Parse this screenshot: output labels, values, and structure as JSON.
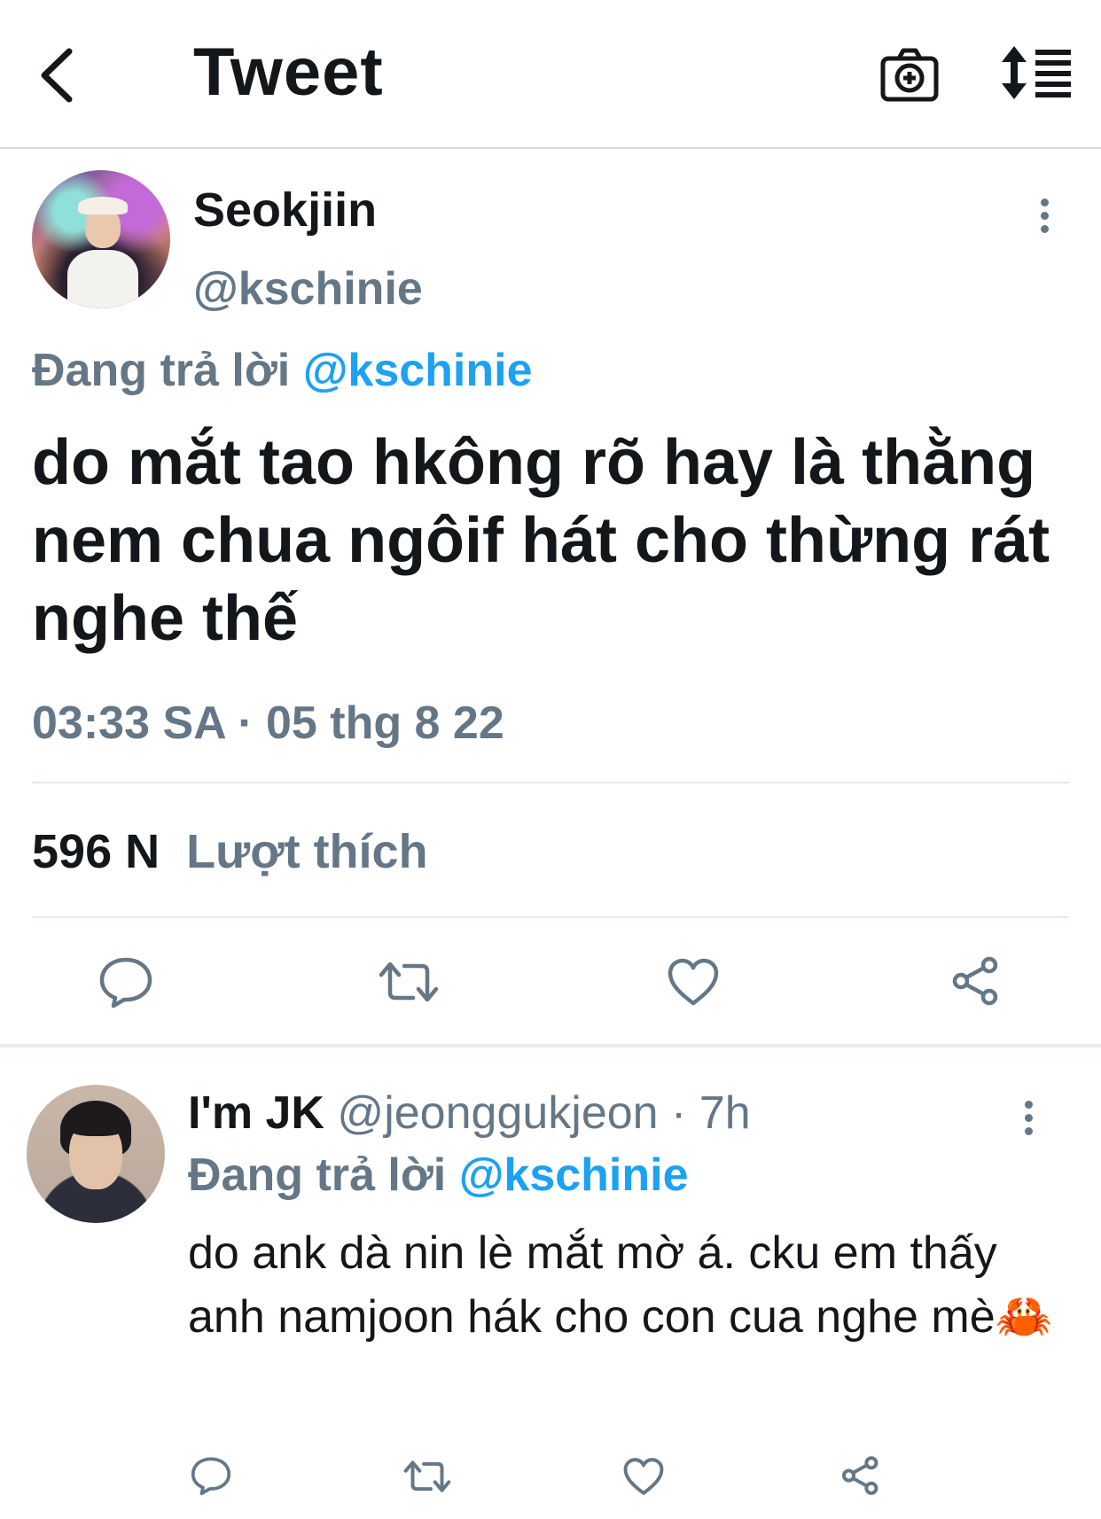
{
  "header": {
    "title": "Tweet",
    "back_icon": "chevron-left-icon",
    "camera_icon": "camera-add-icon",
    "sort_icon": "sort-list-icon"
  },
  "tweet": {
    "author_name": "Seokjiin",
    "author_handle": "@kschinie",
    "replying_prefix": "Đang trả lời",
    "replying_to": "@kschinie",
    "text": "do mắt tao hkông rõ hay là thằng nem chua ngôif hát cho thừng rát nghe thế",
    "timestamp": "03:33 SA · 05 thg 8 22",
    "likes_count": "596 N",
    "likes_label": "Lượt thích",
    "actions": [
      "reply-icon",
      "retweet-icon",
      "like-icon",
      "share-icon"
    ]
  },
  "reply": {
    "author_name": "I'm JK",
    "author_handle": "@jeonggukjeon",
    "separator": " · ",
    "time": "7h",
    "replying_prefix": "Đang trả lời",
    "replying_to": "@kschinie",
    "text": "do ank dà nin lè mắt mờ á. cku em thấy anh namjoon hák cho con cua nghe mè🦀",
    "actions": [
      "reply-icon",
      "retweet-icon",
      "like-icon",
      "share-icon"
    ]
  },
  "colors": {
    "accent": "#1da1f2",
    "secondary_text": "#657786",
    "primary_text": "#14171a",
    "divider": "#e1e8ed"
  }
}
